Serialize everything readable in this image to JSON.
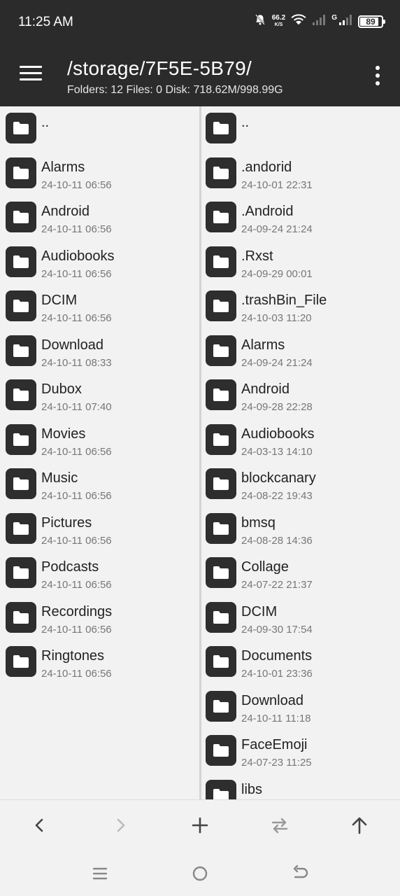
{
  "status_bar": {
    "time": "11:25 AM",
    "net_speed_value": "66.2",
    "net_speed_unit": "K/S",
    "signal_label": "G",
    "battery": "89"
  },
  "header": {
    "path": "/storage/7F5E-5B79/",
    "info": "Folders: 12  Files: 0  Disk: 718.62M/998.99G"
  },
  "left_pane": {
    "up_label": "..",
    "items": [
      {
        "name": "Alarms",
        "date": "24-10-11 06:56"
      },
      {
        "name": "Android",
        "date": "24-10-11 06:56"
      },
      {
        "name": "Audiobooks",
        "date": "24-10-11 06:56"
      },
      {
        "name": "DCIM",
        "date": "24-10-11 06:56"
      },
      {
        "name": "Download",
        "date": "24-10-11 08:33"
      },
      {
        "name": "Dubox",
        "date": "24-10-11 07:40"
      },
      {
        "name": "Movies",
        "date": "24-10-11 06:56"
      },
      {
        "name": "Music",
        "date": "24-10-11 06:56"
      },
      {
        "name": "Pictures",
        "date": "24-10-11 06:56"
      },
      {
        "name": "Podcasts",
        "date": "24-10-11 06:56"
      },
      {
        "name": "Recordings",
        "date": "24-10-11 06:56"
      },
      {
        "name": "Ringtones",
        "date": "24-10-11 06:56"
      }
    ]
  },
  "right_pane": {
    "up_label": "..",
    "items": [
      {
        "name": ".andorid",
        "date": "24-10-01 22:31"
      },
      {
        "name": ".Android",
        "date": "24-09-24 21:24"
      },
      {
        "name": ".Rxst",
        "date": "24-09-29 00:01"
      },
      {
        "name": ".trashBin_File",
        "date": "24-10-03 11:20"
      },
      {
        "name": "Alarms",
        "date": "24-09-24 21:24"
      },
      {
        "name": "Android",
        "date": "24-09-28 22:28"
      },
      {
        "name": "Audiobooks",
        "date": "24-03-13 14:10"
      },
      {
        "name": "blockcanary",
        "date": "24-08-22 19:43"
      },
      {
        "name": "bmsq",
        "date": "24-08-28 14:36"
      },
      {
        "name": "Collage",
        "date": "24-07-22 21:37"
      },
      {
        "name": "DCIM",
        "date": "24-09-30 17:54"
      },
      {
        "name": "Documents",
        "date": "24-10-01 23:36"
      },
      {
        "name": "Download",
        "date": "24-10-11 11:18"
      },
      {
        "name": "FaceEmoji",
        "date": "24-07-23 11:25"
      },
      {
        "name": "libs",
        "date": ""
      }
    ]
  },
  "toolbar": {
    "icons": [
      "back-icon",
      "forward-icon",
      "add-icon",
      "swap-icon",
      "up-arrow-icon"
    ],
    "forward_disabled": true
  },
  "system_nav": {
    "icons": [
      "recents-icon",
      "home-icon",
      "back-nav-icon"
    ]
  }
}
